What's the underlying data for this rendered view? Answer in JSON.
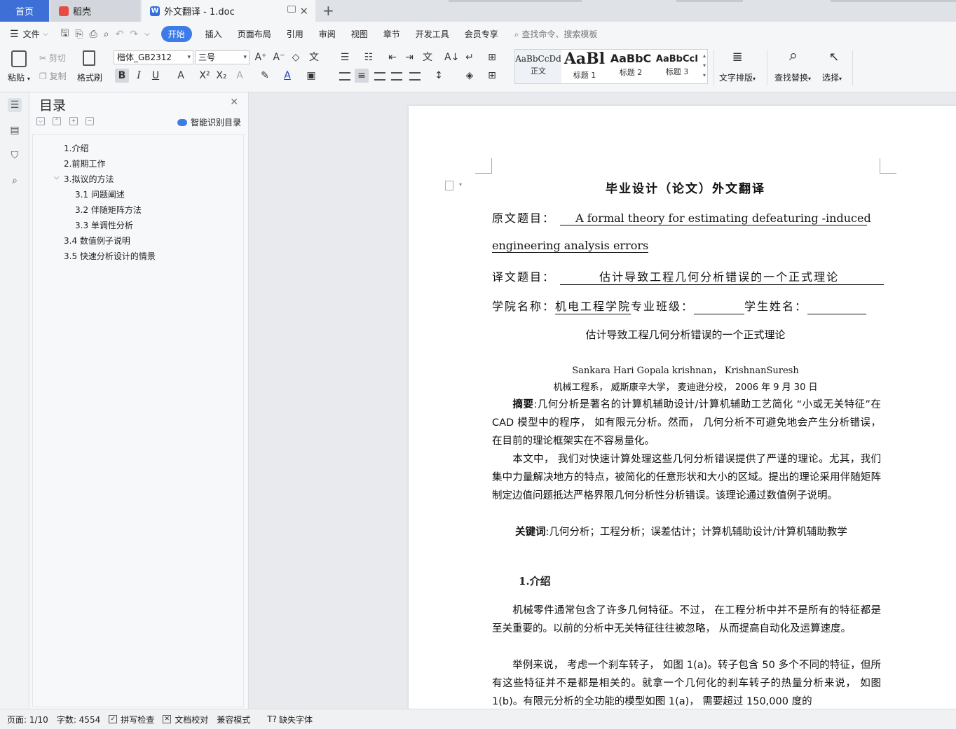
{
  "tabs": {
    "home": "首页",
    "daoke": "稻壳",
    "doc": "外文翻译 - 1.doc"
  },
  "menubar": {
    "file": "文件",
    "items": [
      "开始",
      "插入",
      "页面布局",
      "引用",
      "审阅",
      "视图",
      "章节",
      "开发工具",
      "会员专享"
    ],
    "search": "查找命令、搜索模板"
  },
  "ribbon": {
    "paste": "粘贴",
    "cut": "剪切",
    "copy": "复制",
    "format_painter": "格式刷",
    "font_name": "楷体_GB2312",
    "font_size": "三号",
    "styles": [
      {
        "sample": "AaBbCcDd",
        "name": "正文"
      },
      {
        "sample": "AaBl",
        "name": "标题 1"
      },
      {
        "sample": "AaBbC",
        "name": "标题 2"
      },
      {
        "sample": "AaBbCcI",
        "name": "标题 3"
      }
    ],
    "text_layout": "文字排版",
    "find_replace": "查找替换",
    "select": "选择"
  },
  "toc": {
    "title": "目录",
    "smart": "智能识别目录",
    "items": [
      {
        "label": "1.介绍",
        "level": 1
      },
      {
        "label": "2.前期工作",
        "level": 1
      },
      {
        "label": "3.拟议的方法",
        "level": 1
      },
      {
        "label": "3.1 问题阐述",
        "level": 2
      },
      {
        "label": "3.2 伴随矩阵方法",
        "level": 2
      },
      {
        "label": "3.3 单调性分析",
        "level": 2
      },
      {
        "label": "3.4 数值例子说明",
        "level": 1
      },
      {
        "label": "3.5 快速分析设计的情景",
        "level": 1
      }
    ]
  },
  "document": {
    "title": "毕业设计（论文）外文翻译",
    "orig_label": "原文题目：",
    "orig_title_1": "A formal theory for estimating defeaturing -induced",
    "orig_title_2": "engineering analysis errors",
    "trans_label": "译文题目：",
    "trans_title": "估计导致工程几何分析错误的一个正式理论",
    "college_label": "学院名称：",
    "college": "机电工程学院",
    "class_label": "专业班级：",
    "student_label": "学生姓名：",
    "subtitle": "估计导致工程几何分析错误的一个正式理论",
    "authors": "Sankara Hari Gopala krishnan， KrishnanSuresh",
    "affiliation": "机械工程系， 威斯康辛大学， 麦迪逊分校， 2006 年 9 月 30 日",
    "abstract_label": "摘要",
    "abstract": ":几何分析是著名的计算机辅助设计/计算机辅助工艺简化 “小或无关特征”在 CAD 模型中的程序， 如有限元分析。然而， 几何分析不可避免地会产生分析错误， 在目前的理论框架实在不容易量化。",
    "para2": "本文中， 我们对快速计算处理这些几何分析错误提供了严谨的理论。尤其，我们集中力量解决地方的特点，被简化的任意形状和大小的区域。提出的理论采用伴随矩阵制定边值问题抵达严格界限几何分析性分析错误。该理论通过数值例子说明。",
    "keywords_label": "关键词",
    "keywords": ":几何分析；工程分析；误差估计；计算机辅助设计/计算机辅助教学",
    "section1": "1.介绍",
    "para3": "机械零件通常包含了许多几何特征。不过， 在工程分析中并不是所有的特征都是至关重要的。以前的分析中无关特征往往被忽略， 从而提高自动化及运算速度。",
    "para4": "举例来说， 考虑一个刹车转子， 如图 1(a)。转子包含 50 多个不同的特征，但所有这些特征并不是都是相关的。就拿一个几何化的刹车转子的热量分析来说， 如图 1(b)。有限元分析的全功能的模型如图 1(a)， 需要超过 150,000 度的"
  },
  "status": {
    "page": "页面: 1/10",
    "words": "字数: 4554",
    "spell": "拼写检查",
    "proof": "文档校对",
    "compat": "兼容模式",
    "missing_font": "缺失字体"
  }
}
